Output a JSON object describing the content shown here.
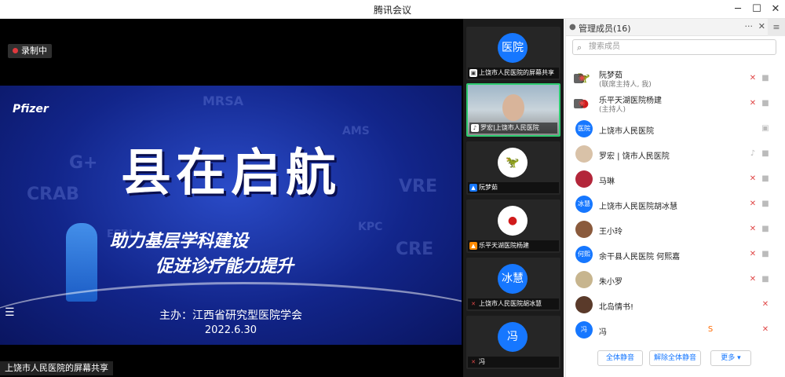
{
  "window": {
    "title": "腾讯会议"
  },
  "stage": {
    "recording_label": "录制中",
    "share_label": "上饶市人民医院的屏幕共享",
    "slide": {
      "logo": "Pfizer",
      "bg_words": [
        "MRSA",
        "AMS",
        "G+",
        "CRAB",
        "VRE",
        "ESBL+",
        "KPC",
        "CRE"
      ],
      "title": "县在启航",
      "subtitle1": "助力基层学科建设",
      "subtitle2": "促进诊疗能力提升",
      "host": "主办：江西省研究型医院学会",
      "date": "2022.6.30"
    }
  },
  "thumbnails": [
    {
      "avatar": "医院",
      "caption": "上饶市人民医院的屏幕共享"
    },
    {
      "avatar": "",
      "caption": "罗宏|上饶市人民医院"
    },
    {
      "avatar": "",
      "caption": "阮梦茹"
    },
    {
      "avatar": "",
      "caption": "乐平天湖医院杨建"
    },
    {
      "avatar": "冰慧",
      "caption": "上饶市人民医院胡冰慧"
    },
    {
      "avatar": "冯",
      "caption": "冯"
    }
  ],
  "panel": {
    "title": "管理成员(16)",
    "search_placeholder": "搜索成员",
    "members": [
      {
        "avatar": "",
        "name": "阮梦茹",
        "role": "(联席主持人, 我)"
      },
      {
        "avatar": "",
        "name": "乐平天湖医院杨建",
        "role": "(主持人)"
      },
      {
        "avatar": "医院",
        "name": "上饶市人民医院",
        "role": ""
      },
      {
        "avatar": "",
        "name": "罗宏 | 饶市人民医院",
        "role": ""
      },
      {
        "avatar": "",
        "name": "马琳",
        "role": ""
      },
      {
        "avatar": "冰慧",
        "name": "上饶市人民医院胡冰慧",
        "role": ""
      },
      {
        "avatar": "",
        "name": "王小玲",
        "role": ""
      },
      {
        "avatar": "何熙",
        "name": "余干县人民医院 何熙嘉",
        "role": ""
      },
      {
        "avatar": "",
        "name": "朱小罗",
        "role": ""
      },
      {
        "avatar": "",
        "name": "北岛情书!",
        "role": ""
      },
      {
        "avatar": "冯",
        "name": "冯",
        "role": ""
      }
    ],
    "buttons": {
      "mute_all": "全体静音",
      "unmute_all": "解除全体静音",
      "more": "更多 ▾"
    }
  }
}
